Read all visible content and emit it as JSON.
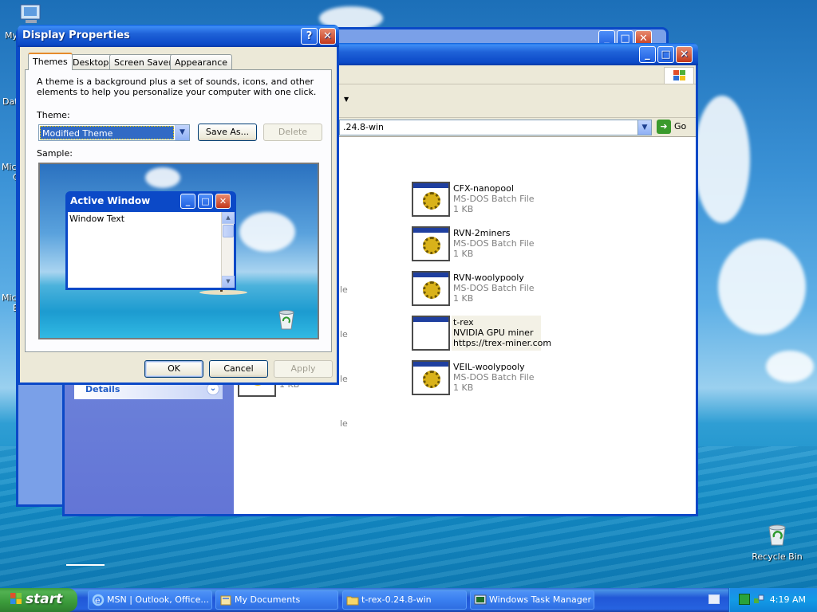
{
  "desktop": {
    "left_clips": [
      "My",
      "Dat",
      "Micro",
      "C",
      "Micro",
      "B"
    ],
    "recycle_bin_label": "Recycle Bin"
  },
  "explorer": {
    "address_value": ".24.8-win",
    "go_label": "Go",
    "details_label": "Details",
    "files": [
      {
        "name": "CFX-nanopool",
        "line2": "MS-DOS Batch File",
        "line3": "1 KB",
        "icon": "batch-gear-icon"
      },
      {
        "name": "RVN-2miners",
        "line2": "MS-DOS Batch File",
        "line3": "1 KB",
        "icon": "batch-gear-icon"
      },
      {
        "name": "RVN-woolypooly",
        "line2": "MS-DOS Batch File",
        "line3": "1 KB",
        "icon": "batch-gear-icon"
      },
      {
        "name": "t-rex",
        "line2": "NVIDIA GPU miner",
        "line3": "https://trex-miner.com",
        "icon": "application-icon"
      },
      {
        "name": "VEIL-woolypooly",
        "line2": "MS-DOS Batch File",
        "line3": "1 KB",
        "icon": "batch-gear-icon"
      }
    ],
    "left_column_clips": [
      "le",
      "le",
      "le",
      "le"
    ],
    "partial_size": "1 KB"
  },
  "dialog": {
    "title": "Display Properties",
    "help_label": "?",
    "close_label": "✕",
    "tabs": [
      {
        "label": "Themes",
        "active": true
      },
      {
        "label": "Desktop",
        "active": false
      },
      {
        "label": "Screen Saver",
        "active": false
      },
      {
        "label": "Appearance",
        "active": false
      }
    ],
    "description": "A theme is a background plus a set of sounds, icons, and other elements to help you personalize your computer with one click.",
    "theme_label": "Theme:",
    "theme_value": "Modified Theme",
    "save_as_label": "Save As...",
    "delete_label": "Delete",
    "sample_label": "Sample:",
    "sample_window_title": "Active Window",
    "sample_window_text": "Window Text",
    "ok_label": "OK",
    "cancel_label": "Cancel",
    "apply_label": "Apply"
  },
  "taskbar": {
    "start_label": "start",
    "items": [
      {
        "label": "MSN | Outlook, Office...",
        "icon": "ie-icon",
        "active": false
      },
      {
        "label": "My Documents",
        "icon": "my-documents-icon",
        "active": false
      },
      {
        "label": "t-rex-0.24.8-win",
        "icon": "folder-icon",
        "active": false
      },
      {
        "label": "Windows Task Manager",
        "icon": "task-manager-icon",
        "active": false
      }
    ],
    "clock": "4:19 AM"
  },
  "colors": {
    "title_blue": "#0b49c7",
    "start_green": "#3a9a3a",
    "tray_blue": "#139ae6"
  }
}
